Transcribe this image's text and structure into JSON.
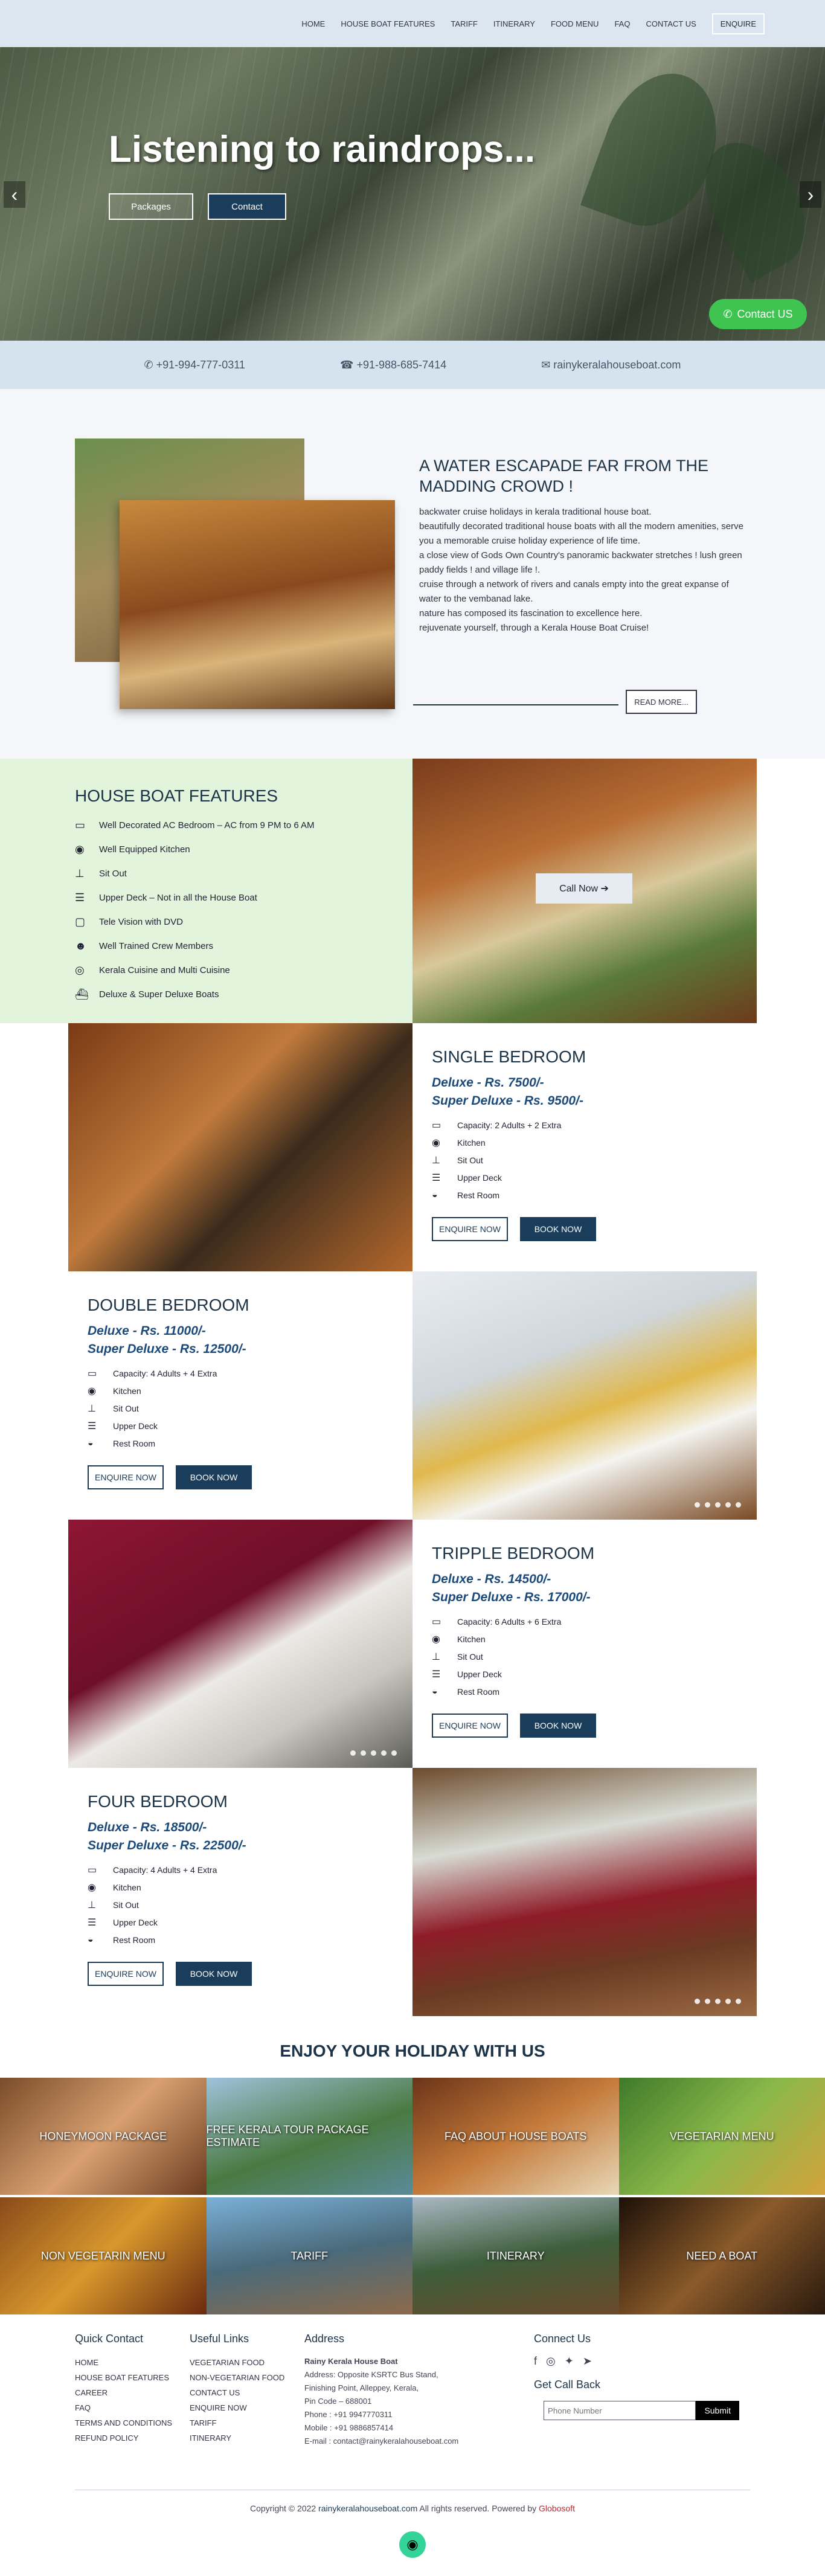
{
  "nav": {
    "items": [
      "HOME",
      "HOUSE BOAT FEATURES",
      "TARIFF",
      "ITINERARY",
      "FOOD MENU",
      "FAQ",
      "CONTACT US"
    ],
    "enquire": "ENQUIRE"
  },
  "hero": {
    "title": "Listening to raindrops...",
    "btn_packages": "Packages",
    "btn_contact": "Contact",
    "whatsapp": "Contact US"
  },
  "contact": {
    "phone1": "+91-994-777-0311",
    "phone2": "+91-988-685-7414",
    "email": "rainykeralahouseboat.com"
  },
  "about": {
    "title": "A WATER ESCAPADE FAR FROM THE MADDING CROWD !",
    "lines": [
      "backwater cruise holidays in kerala traditional house boat.",
      "beautifully decorated traditional house boats with all the modern amenities, serve you a memorable cruise holiday experience of life time.",
      "a close view of Gods Own Country's panoramic backwater stretches ! lush green paddy fields ! and village life !.",
      "cruise through a network of rivers and canals empty into the great expanse of water to the vembanad lake.",
      "nature has composed its fascination to excellence here.",
      "rejuvenate yourself, through a Kerala House Boat Cruise!"
    ],
    "read_more": "READ MORE..."
  },
  "features": {
    "title": "HOUSE BOAT FEATURES",
    "items": [
      "Well Decorated AC Bedroom – AC from 9 PM to 6 AM",
      "Well Equipped Kitchen",
      "Sit Out",
      "Upper Deck – Not in all the House Boat",
      "Tele Vision with DVD",
      "Well Trained Crew Members",
      "Kerala Cuisine and Multi Cuisine",
      "Deluxe & Super Deluxe Boats"
    ],
    "call_now": "Call Now ➔"
  },
  "rooms": [
    {
      "title": "SINGLE BEDROOM",
      "deluxe": "Deluxe - Rs. 7500/-",
      "super": "Super Deluxe - Rs. 9500/-",
      "items": [
        "Capacity: 2 Adults + 2 Extra",
        "Kitchen",
        "Sit Out",
        "Upper Deck",
        "Rest Room"
      ]
    },
    {
      "title": "DOUBLE BEDROOM",
      "deluxe": "Deluxe - Rs. 11000/-",
      "super": "Super Deluxe - Rs. 12500/-",
      "items": [
        "Capacity: 4 Adults + 4 Extra",
        "Kitchen",
        "Sit Out",
        "Upper Deck",
        "Rest Room"
      ]
    },
    {
      "title": "TRIPPLE BEDROOM",
      "deluxe": "Deluxe - Rs. 14500/-",
      "super": "Super Deluxe - Rs. 17000/-",
      "items": [
        "Capacity: 6 Adults + 6 Extra",
        "Kitchen",
        "Sit Out",
        "Upper Deck",
        "Rest Room"
      ]
    },
    {
      "title": "FOUR BEDROOM",
      "deluxe": "Deluxe - Rs. 18500/-",
      "super": "Super Deluxe - Rs. 22500/-",
      "items": [
        "Capacity: 4 Adults + 4 Extra",
        "Kitchen",
        "Sit Out",
        "Upper Deck",
        "Rest Room"
      ]
    }
  ],
  "room_btns": {
    "enquire": "ENQUIRE NOW",
    "book": "BOOK NOW"
  },
  "enjoy": {
    "title": "ENJOY YOUR HOLIDAY WITH US",
    "tiles": [
      "HONEYMOON PACKAGE",
      "FREE KERALA TOUR PACKAGE ESTIMATE",
      "FAQ ABOUT HOUSE BOATS",
      "VEGETARIAN MENU",
      "NON VEGETARIN MENU",
      "TARIFF",
      "ITINERARY",
      "NEED A BOAT"
    ]
  },
  "footer": {
    "quick_title": "Quick Contact",
    "quick": [
      "HOME",
      "HOUSE BOAT FEATURES",
      "CAREER",
      "FAQ",
      "TERMS AND CONDITIONS",
      "REFUND POLICY"
    ],
    "useful_title": "Useful Links",
    "useful": [
      "VEGETARIAN FOOD",
      "NON-VEGETARIAN FOOD",
      "CONTACT US",
      "ENQUIRE NOW",
      "TARIFF",
      "ITINERARY"
    ],
    "address_title": "Address",
    "company": "Rainy Kerala House Boat",
    "address": [
      "Address: Opposite KSRTC Bus Stand,",
      "Finishing Point, Alleppey, Kerala,",
      "Pin Code – 688001",
      "Phone : +91 9947770311",
      "Mobile : +91 9886857414",
      "E-mail : contact@rainykeralahouseboat.com"
    ],
    "connect_title": "Connect Us",
    "callback_title": "Get Call Back",
    "phone_placeholder": "Phone Number",
    "submit": "Submit"
  },
  "copyright": {
    "pre": "Copyright © 2022",
    "site": "rainykeralahouseboat.com",
    "mid": "All rights reserved. Powered by",
    "by": "Globosoft"
  }
}
